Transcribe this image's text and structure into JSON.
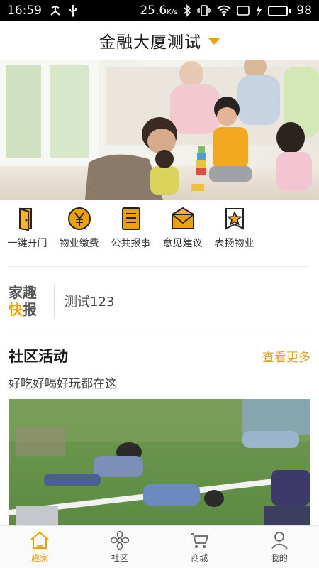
{
  "status_bar": {
    "time": "16:59",
    "network_speed": "25.6",
    "network_unit": "K/s",
    "battery_level": "98",
    "battery_fraction": 0.98
  },
  "header": {
    "title": "金融大厦测试",
    "dropdown_icon": "caret-down-icon"
  },
  "banner": {
    "image": "family-playing-with-blocks-photo"
  },
  "quick_actions": [
    {
      "label": "一键开门",
      "icon": "door-icon"
    },
    {
      "label": "物业缴费",
      "icon": "yuan-coin-icon"
    },
    {
      "label": "公共报事",
      "icon": "document-icon"
    },
    {
      "label": "意见建议",
      "icon": "envelope-icon"
    },
    {
      "label": "表扬物业",
      "icon": "star-badge-icon"
    }
  ],
  "news": {
    "logo_line1": "家趣",
    "logo_line2_a": "快",
    "logo_line2_b": "报",
    "text": "测试123"
  },
  "activities": {
    "title": "社区活动",
    "more": "查看更多",
    "subtitle": "好吃好喝好玩都在这",
    "image": "kids-playing-on-grass-photo"
  },
  "tabs": [
    {
      "label": "趣家",
      "icon": "home-icon",
      "active": true
    },
    {
      "label": "社区",
      "icon": "flower-icon",
      "active": false
    },
    {
      "label": "商城",
      "icon": "cart-icon",
      "active": false
    },
    {
      "label": "我的",
      "icon": "person-icon",
      "active": false
    }
  ],
  "colors": {
    "accent": "#f0a100",
    "more_link": "#e0a52e",
    "status_bar": "#000000",
    "battery": "#3cd24a"
  }
}
